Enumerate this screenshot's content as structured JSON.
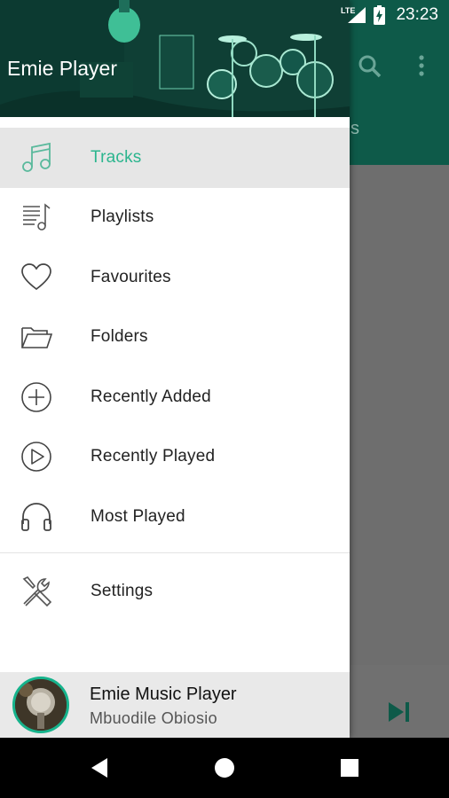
{
  "status_bar": {
    "time": "23:23",
    "network": "LTE"
  },
  "drawer": {
    "header_title": "Emie Player",
    "menu": [
      {
        "label": "Tracks",
        "icon": "music-note-icon",
        "active": true
      },
      {
        "label": "Playlists",
        "icon": "playlist-icon",
        "active": false
      },
      {
        "label": "Favourites",
        "icon": "heart-icon",
        "active": false
      },
      {
        "label": "Folders",
        "icon": "folder-icon",
        "active": false
      },
      {
        "label": "Recently Added",
        "icon": "plus-circle-icon",
        "active": false
      },
      {
        "label": "Recently Played",
        "icon": "play-circle-icon",
        "active": false
      },
      {
        "label": "Most Played",
        "icon": "headphones-icon",
        "active": false
      }
    ],
    "settings": {
      "label": "Settings",
      "icon": "tools-icon"
    },
    "footer": {
      "title": "Emie Music Player",
      "subtitle": "Mbuodile Obiosio"
    }
  },
  "background": {
    "tab_fragment": "s"
  },
  "colors": {
    "accent": "#2bb58e",
    "toolbar": "#0e5a49",
    "active_row": "#e6e6e6"
  }
}
